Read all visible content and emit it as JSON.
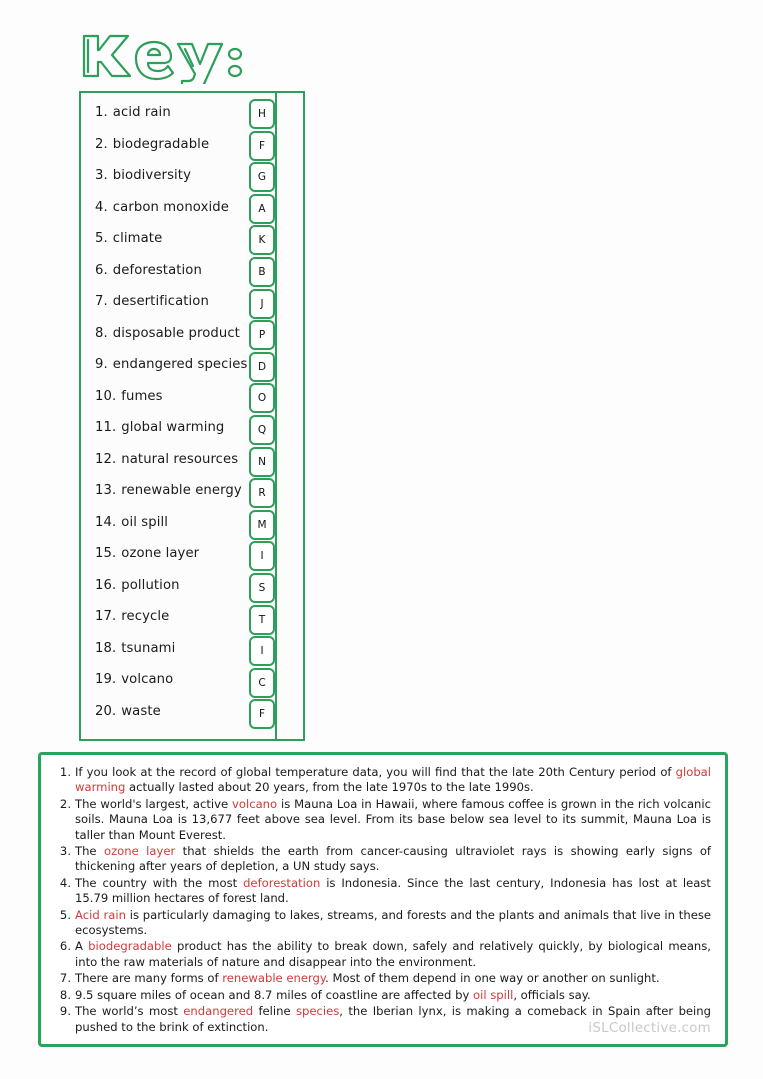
{
  "page": {
    "title_text": "Key:",
    "accent_green": "#2e9e5b",
    "highlight_red": "#cf3b38",
    "watermark": "iSLCollective.com"
  },
  "key_list": {
    "items": [
      {
        "number": "1.",
        "term": "acid rain",
        "answer": "H"
      },
      {
        "number": "2.",
        "term": "biodegradable",
        "answer": "F"
      },
      {
        "number": "3.",
        "term": "biodiversity",
        "answer": "G"
      },
      {
        "number": "4.",
        "term": "carbon monoxide",
        "answer": "A"
      },
      {
        "number": "5.",
        "term": "climate",
        "answer": "K"
      },
      {
        "number": "6.",
        "term": "deforestation",
        "answer": "B"
      },
      {
        "number": "7.",
        "term": "desertification",
        "answer": "J"
      },
      {
        "number": "8.",
        "term": "disposable product",
        "answer": "P"
      },
      {
        "number": "9.",
        "term": "endangered species",
        "answer": "D"
      },
      {
        "number": "10.",
        "term": "fumes",
        "answer": "O"
      },
      {
        "number": "11.",
        "term": "global warming",
        "answer": "Q"
      },
      {
        "number": "12.",
        "term": "natural resources",
        "answer": "N"
      },
      {
        "number": "13.",
        "term": "renewable energy",
        "answer": "R"
      },
      {
        "number": "14.",
        "term": "oil spill",
        "answer": "M"
      },
      {
        "number": "15.",
        "term": "ozone layer",
        "answer": "I"
      },
      {
        "number": "16.",
        "term": "pollution",
        "answer": "S"
      },
      {
        "number": "17.",
        "term": "recycle",
        "answer": "T"
      },
      {
        "number": "18.",
        "term": "tsunami",
        "answer": "I"
      },
      {
        "number": "19.",
        "term": "volcano",
        "answer": "C"
      },
      {
        "number": "20.",
        "term": "waste",
        "answer": "F"
      }
    ]
  },
  "sentences": [
    {
      "parts": [
        {
          "t": "If you look at the record of global temperature data, you will find that the late 20th Century period of ",
          "hl": false
        },
        {
          "t": "global warming",
          "hl": true
        },
        {
          "t": " actually lasted about 20 years, from the late 1970s to the late 1990s.",
          "hl": false
        }
      ]
    },
    {
      "parts": [
        {
          "t": "The world's largest, active ",
          "hl": false
        },
        {
          "t": "volcano",
          "hl": true
        },
        {
          "t": " is Mauna Loa in Hawaii, where famous coffee is grown in the rich volcanic soils. Mauna Loa is 13,677 feet above sea level. From its base below sea level to its summit, Mauna Loa is taller than Mount Everest.",
          "hl": false
        }
      ]
    },
    {
      "parts": [
        {
          "t": "The ",
          "hl": false
        },
        {
          "t": "ozone layer",
          "hl": true
        },
        {
          "t": " that shields the earth from cancer-causing ultraviolet rays is showing early signs of thickening after years of depletion, a UN study says.",
          "hl": false
        }
      ]
    },
    {
      "parts": [
        {
          "t": "The country with the most ",
          "hl": false
        },
        {
          "t": "deforestation",
          "hl": true
        },
        {
          "t": " is Indonesia. Since the last century, Indonesia has lost at least 15.79 million hectares of forest land.",
          "hl": false
        }
      ]
    },
    {
      "parts": [
        {
          "t": "Acid rain",
          "hl": true
        },
        {
          "t": " is particularly damaging to lakes, streams, and forests and the plants and animals that live in these ecosystems.",
          "hl": false
        }
      ]
    },
    {
      "parts": [
        {
          "t": "A ",
          "hl": false
        },
        {
          "t": "biodegradable",
          "hl": true
        },
        {
          "t": " product has the ability to break down, safely and relatively quickly, by biological means, into the raw materials of nature and disappear into the environment.",
          "hl": false
        }
      ]
    },
    {
      "parts": [
        {
          "t": "There are many forms of ",
          "hl": false
        },
        {
          "t": "renewable energy",
          "hl": true
        },
        {
          "t": ". Most of them depend in one way or another on sunlight.",
          "hl": false
        }
      ]
    },
    {
      "parts": [
        {
          "t": "9.5 square miles of ocean and 8.7 miles of coastline are affected by ",
          "hl": false
        },
        {
          "t": "oil spill",
          "hl": true
        },
        {
          "t": ", officials say.",
          "hl": false
        }
      ]
    },
    {
      "parts": [
        {
          "t": "The world’s most ",
          "hl": false
        },
        {
          "t": "endangered",
          "hl": true
        },
        {
          "t": " feline ",
          "hl": false
        },
        {
          "t": "species",
          "hl": true
        },
        {
          "t": ", the Iberian lynx, is making a comeback in Spain after being pushed to the brink of extinction.",
          "hl": false
        }
      ]
    }
  ]
}
